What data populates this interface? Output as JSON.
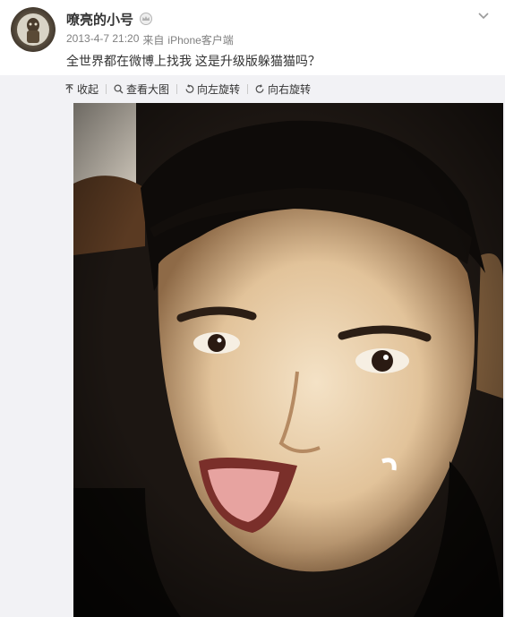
{
  "post": {
    "username": "嘹亮的小号",
    "timestamp": "2013-4-7 21:20",
    "source_prefix": "来自",
    "source": "iPhone客户端",
    "text": "全世界都在微博上找我 这是升级版躲猫猫吗？"
  },
  "toolbar": {
    "collapse_label": "收起",
    "view_large_label": "查看大图",
    "rotate_left_label": "向左旋转",
    "rotate_right_label": "向右旋转"
  },
  "icons": {
    "avatar": "avatar",
    "crown": "crown-icon",
    "chevron": "chevron-down-icon",
    "collapse": "collapse-icon",
    "search": "search-icon",
    "rotate_left": "rotate-left-icon",
    "rotate_right": "rotate-right-icon"
  },
  "colors": {
    "username": "#333333",
    "meta": "#808080",
    "panel_bg": "#f2f2f5"
  }
}
